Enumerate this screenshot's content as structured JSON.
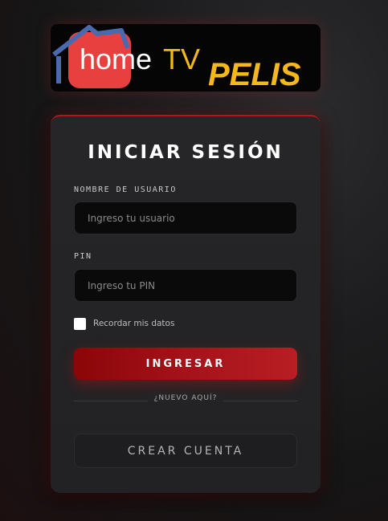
{
  "logo": {
    "brand_home": "home",
    "brand_tv": "TV",
    "brand_pelis": "PELIS"
  },
  "login": {
    "title": "INICIAR SESIÓN",
    "username_label": "NOMBRE DE USUARIO",
    "username_placeholder": "Ingreso tu usuario",
    "username_value": "",
    "pin_label": "PIN",
    "pin_placeholder": "Ingreso tu PIN",
    "pin_value": "",
    "remember_label": "Recordar mis datos",
    "remember_checked": false,
    "submit_label": "INGRESAR",
    "divider_text": "¿NUEVO AQUÍ?",
    "create_account_label": "CREAR CUENTA"
  },
  "colors": {
    "accent": "#b3161b",
    "brand_yellow": "#f5b81c",
    "brand_red": "#e8403f"
  },
  "icons": {
    "logo_icon": "house-tv-icon"
  }
}
